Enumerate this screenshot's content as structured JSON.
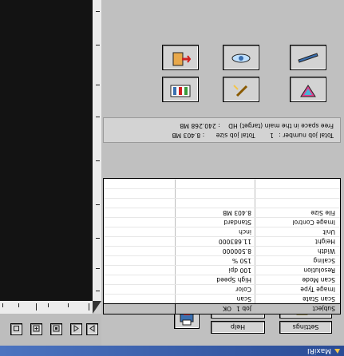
{
  "taskbar": {
    "title": "MaxiRI"
  },
  "buttons": {
    "settings": "Settings",
    "help": "Help"
  },
  "table": {
    "header": [
      "Subject",
      "Job 1",
      "OK"
    ],
    "rows": [
      [
        "Scan State",
        "Scan"
      ],
      [
        "Image Type",
        "Color"
      ],
      [
        "Scan Mode",
        "High Speed"
      ],
      [
        "Resolution",
        "100 dpi"
      ],
      [
        "Scaling",
        "150 %"
      ],
      [
        "Width",
        "8.500000"
      ],
      [
        "Height",
        "11.683000"
      ],
      [
        "Unit",
        "inch"
      ],
      [
        "Image Control",
        "Standard"
      ],
      [
        "File Size",
        "8.403   MB"
      ],
      [
        "",
        ""
      ],
      [
        "",
        ""
      ],
      [
        "",
        ""
      ]
    ]
  },
  "info": {
    "job_number_label": "Total job number :",
    "job_number_value": "1",
    "job_size_label": "Total job size",
    "job_size_value": ": 8.403  MB",
    "free_space_label": "Free space in the main (target) HD",
    "free_space_value": ":    240.268 MB"
  },
  "icons": {
    "tools": [
      "exit-door-icon",
      "eye-preview-icon",
      "ruler-icon",
      "film-strip-icon",
      "pen-tool-icon",
      "color-triangle-icon"
    ],
    "small": [
      "target-icon",
      "page-icon",
      "copy-icon",
      "save-icon",
      "sort-icon",
      "crop-icon",
      "select-icon",
      "delete-icon"
    ]
  }
}
